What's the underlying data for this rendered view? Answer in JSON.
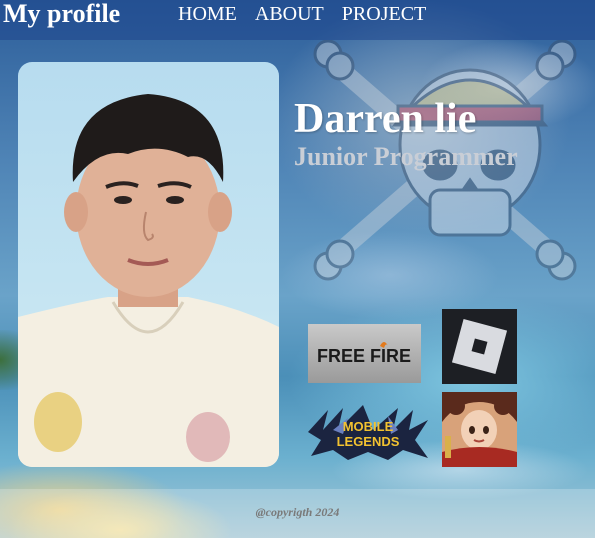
{
  "header": {
    "brand": "My profile",
    "nav": [
      {
        "label": "HOME"
      },
      {
        "label": "ABOUT"
      },
      {
        "label": "PROJECT"
      }
    ]
  },
  "profile": {
    "name": "Darren lie",
    "role": "Junior Programmer"
  },
  "games": [
    {
      "name": "FREE FIRE",
      "icon": "free-fire-logo"
    },
    {
      "name": "Roblox",
      "icon": "roblox-logo"
    },
    {
      "name_lines": [
        "MOBILE",
        "LEGENDS"
      ],
      "icon": "mobile-legends-logo"
    },
    {
      "icon": "hero-portrait-logo"
    }
  ],
  "footer": {
    "copyright": "@copyrigth 2024"
  },
  "colors": {
    "header_bg": "#1e468c",
    "text_primary": "#ffffff",
    "role_text": "#c9ced6",
    "footer_text": "#7a7a7a"
  }
}
